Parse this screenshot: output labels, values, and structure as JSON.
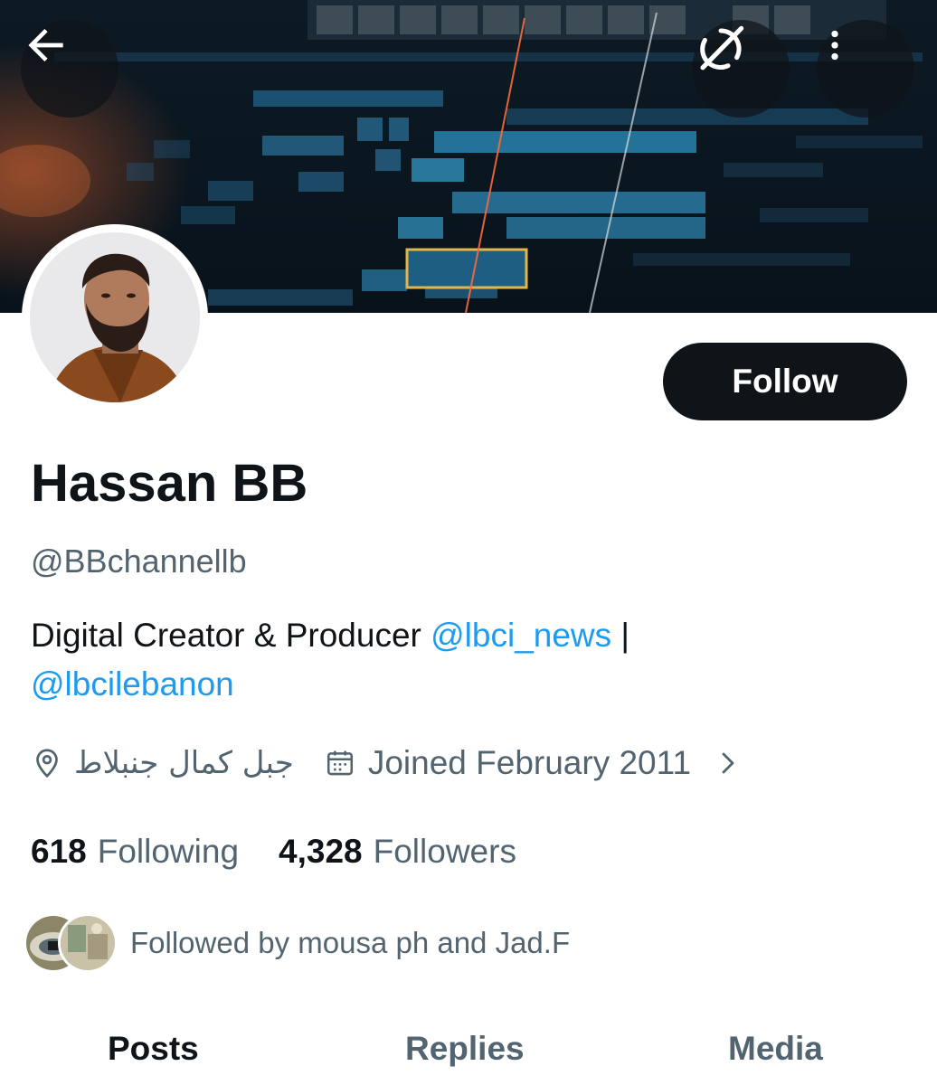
{
  "header": {
    "back_icon": "arrow-left-icon",
    "grok_icon": "grok-icon",
    "more_icon": "more-vertical-icon"
  },
  "profile": {
    "display_name": "Hassan BB",
    "handle": "@BBchannellb",
    "follow_label": "Follow",
    "bio": {
      "text": "Digital Creator & Producer ",
      "mention1": "@lbci_news",
      "separator": " |",
      "mention2": "@lbcilebanon"
    },
    "location": "جبل كمال جنبلاط",
    "joined": "Joined February 2011"
  },
  "stats": {
    "following_count": "618",
    "following_label": "Following",
    "followers_count": "4,328",
    "followers_label": "Followers"
  },
  "followed_by": "Followed by mousa ph and Jad.F",
  "tabs": [
    "Posts",
    "Replies",
    "Media"
  ],
  "colors": {
    "text": "#0f1419",
    "secondary": "#536471",
    "link": "#1d9bf0",
    "button": "#0f1419"
  }
}
